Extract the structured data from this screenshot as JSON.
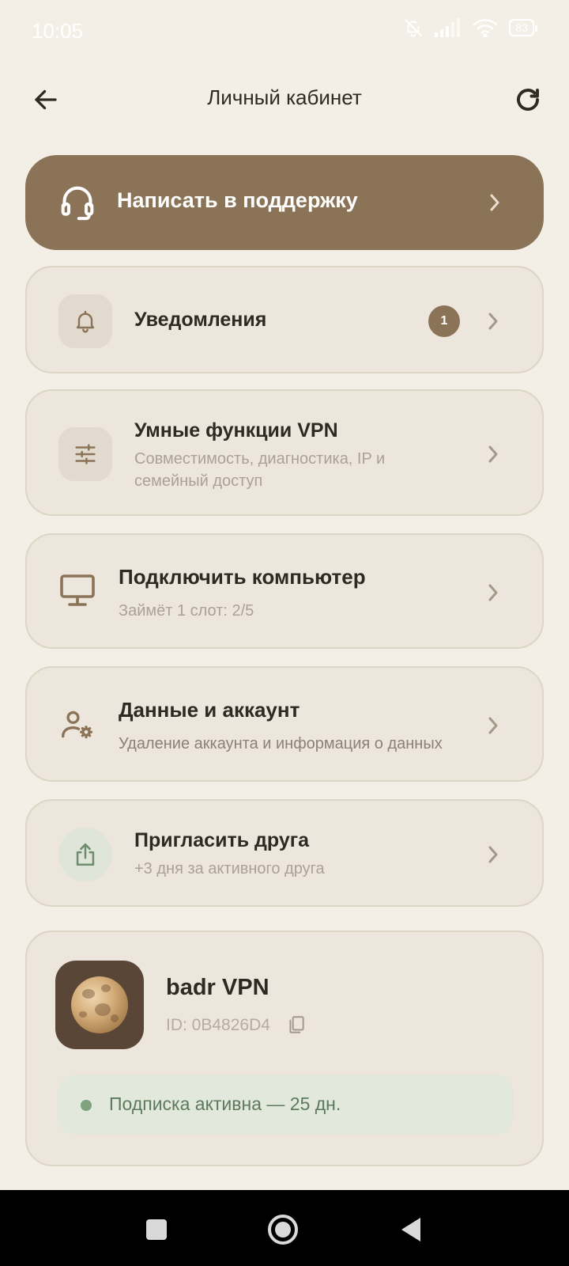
{
  "status_bar": {
    "time": "10:05",
    "battery": "83",
    "icons": [
      "bell-off-icon",
      "signal-icon",
      "wifi-icon",
      "battery-icon"
    ]
  },
  "header": {
    "title": "Личный кабинет",
    "back_icon": "arrow-left-icon",
    "refresh_icon": "refresh-icon"
  },
  "support": {
    "label": "Написать в поддержку",
    "icon": "headset-icon"
  },
  "menu": {
    "notifications": {
      "title": "Уведомления",
      "badge": "1",
      "icon": "bell-icon"
    },
    "smart": {
      "title": "Умные функции VPN",
      "subtitle_line1": "Совместимость, диагностика, IP и",
      "subtitle_line2": "семейный доступ",
      "icon": "sliders-icon"
    },
    "computer": {
      "title": "Подключить компьютер",
      "subtitle": "Займёт 1 слот: 2/5",
      "icon": "monitor-icon"
    },
    "account": {
      "title": "Данные и аккаунт",
      "subtitle": "Удаление аккаунта и информация о данных",
      "icon": "user-gear-icon"
    },
    "invite": {
      "title": "Пригласить друга",
      "subtitle": "+3 дня за активного друга",
      "icon": "share-icon"
    }
  },
  "profile": {
    "name": "badr VPN",
    "id": "ID: 0B4826D4",
    "subscription": "Подписка активна — 25 дн."
  },
  "colors": {
    "background": "#f4efe6",
    "accent": "#8a7356",
    "card": "#ece6dc",
    "success": "#7ea17e"
  }
}
